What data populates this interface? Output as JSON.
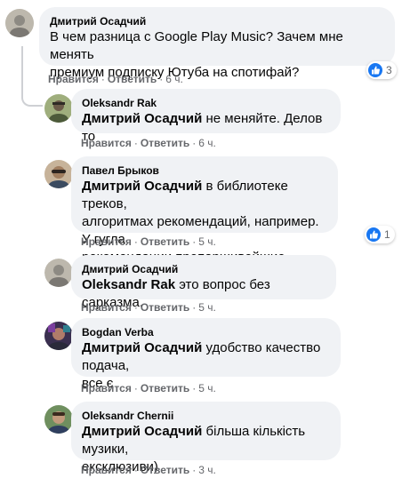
{
  "comments": [
    {
      "author": "Дмитрий Осадчий",
      "mention": "",
      "text_lines": [
        "В чем разница с Google Play Music? Зачем мне менять",
        "премиум подписку Ютуба на спотифай?"
      ],
      "like": "Нравится",
      "reply": "Ответить",
      "time": "6 ч.",
      "reaction_count": "3"
    },
    {
      "author": "Oleksandr Rak",
      "mention": "Дмитрий Осадчий",
      "text": "не меняйте. Делов то",
      "like": "Нравится",
      "reply": "Ответить",
      "time": "6 ч."
    },
    {
      "author": "Павел Брыков",
      "mention": "Дмитрий Осадчий",
      "text_lines": [
        "в библиотеке треков,",
        "алгоритмах рекомендаций, например. У гугла",
        "рекомендации препаршивейшие"
      ],
      "like": "Нравится",
      "reply": "Ответить",
      "time": "5 ч.",
      "reaction_count": "1"
    },
    {
      "author": "Дмитрий Осадчий",
      "mention": "Oleksandr Rak",
      "text": "это вопрос без сарказма.",
      "like": "Нравится",
      "reply": "Ответить",
      "time": "5 ч."
    },
    {
      "author": "Bogdan Verba",
      "mention": "Дмитрий Осадчий",
      "text_lines": [
        "удобство качество подача,",
        "все є"
      ],
      "like": "Нравится",
      "reply": "Ответить",
      "time": "5 ч."
    },
    {
      "author": "Oleksandr Chernii",
      "mention": "Дмитрий Осадчий",
      "text_lines": [
        "більша кількість музики,",
        "ексклюзиви)"
      ],
      "like": "Нравится",
      "reply": "Ответить",
      "time": "3 ч."
    }
  ],
  "colors": {
    "bubble": "#f0f2f5",
    "meta": "#65676b",
    "like_blue": "#1877f2"
  },
  "icons": {
    "reaction": "like-icon",
    "separator": "·"
  }
}
